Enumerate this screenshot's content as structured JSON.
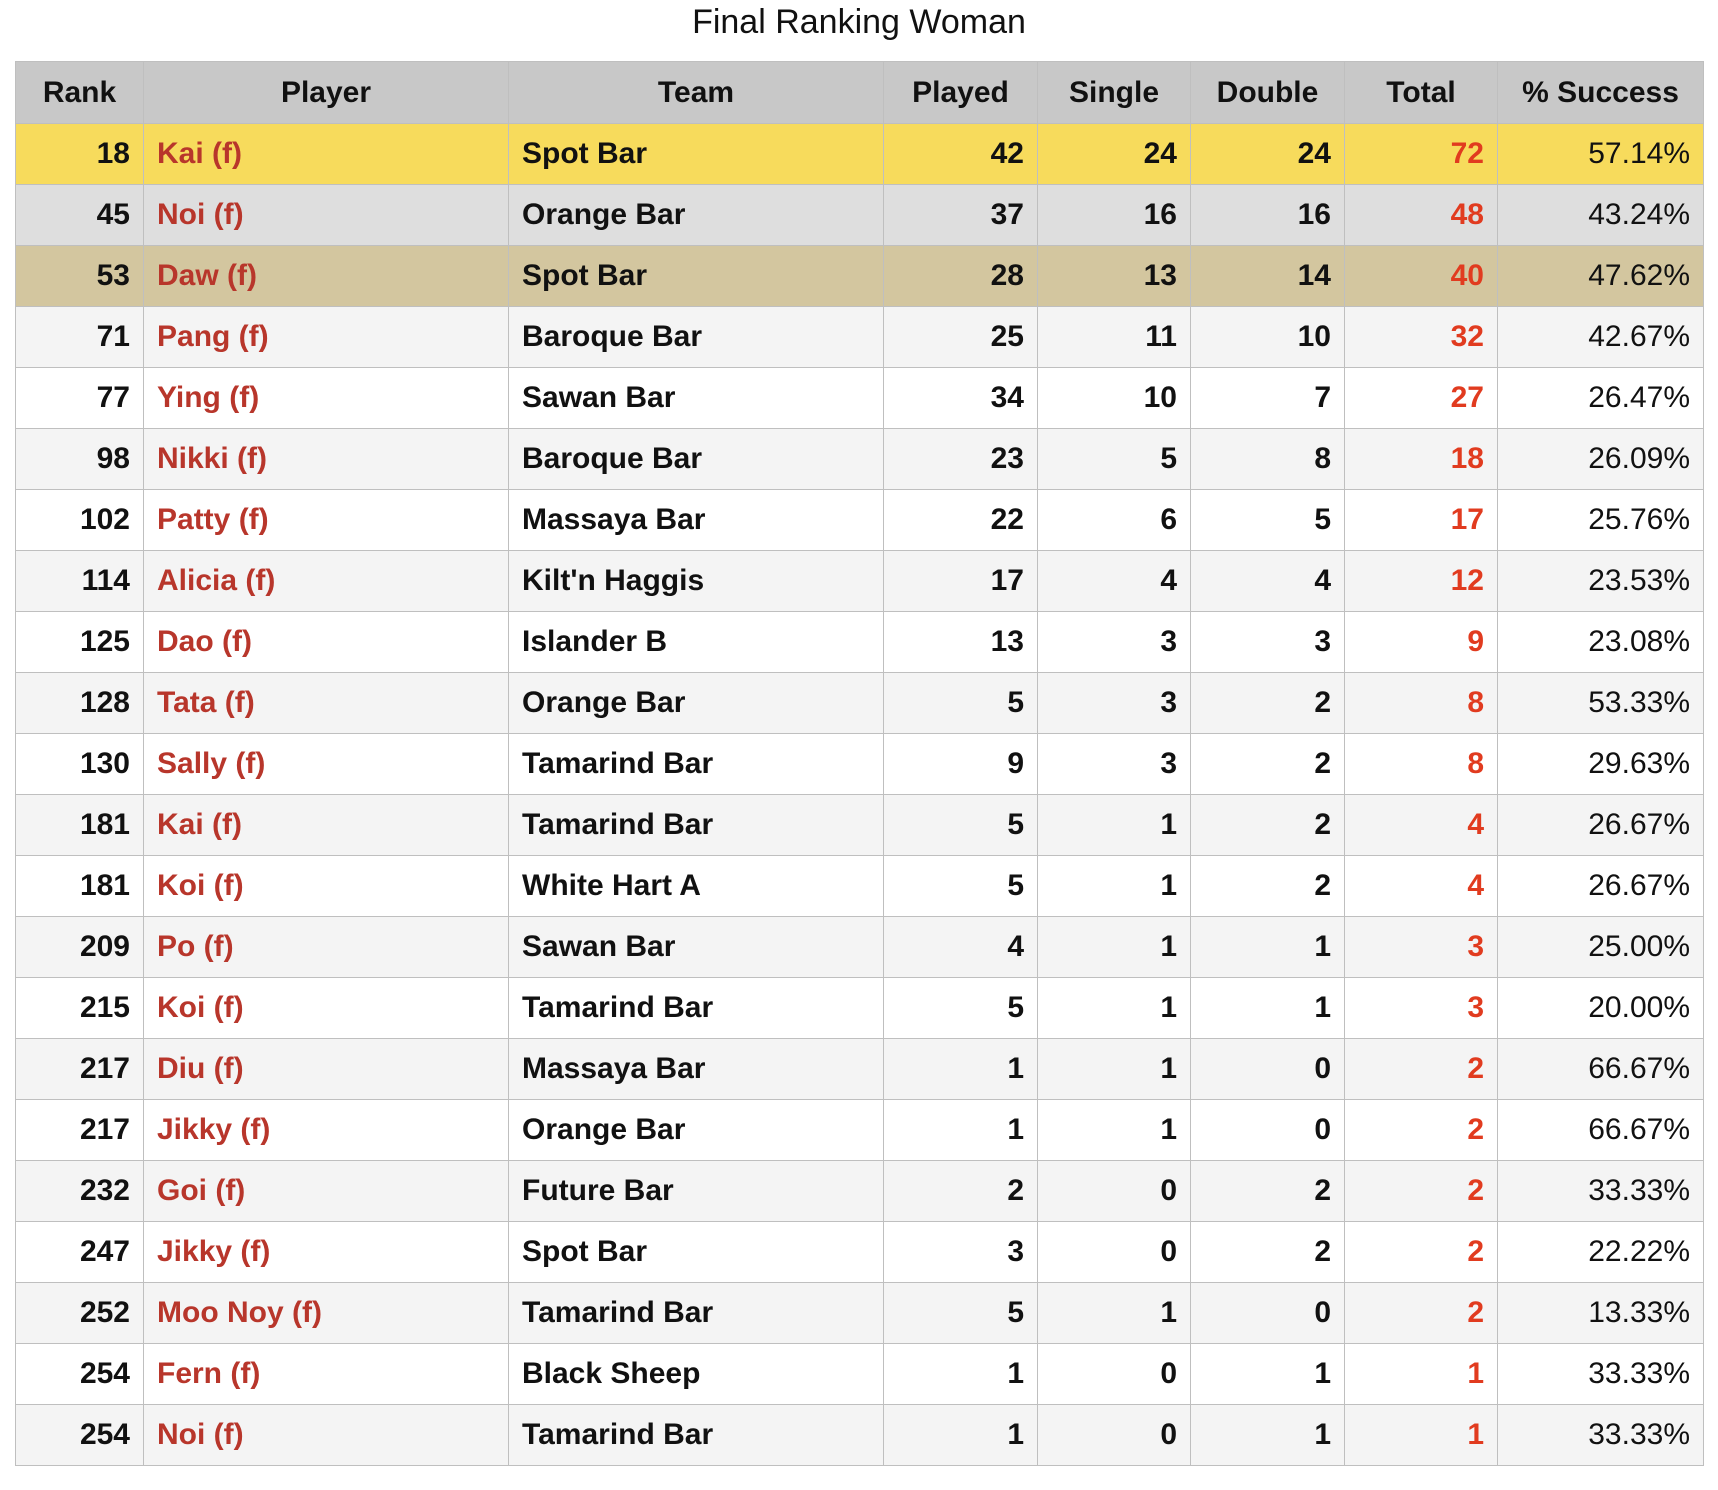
{
  "title": "Final Ranking Woman",
  "columns": [
    "Rank",
    "Player",
    "Team",
    "Played",
    "Single",
    "Double",
    "Total",
    "% Success"
  ],
  "colors": {
    "header_bg": "#c8c8c8",
    "first_place_bg": "#f7db5c",
    "second_place_bg": "#dedede",
    "third_place_bg": "#d3c69f",
    "player_text": "#b8362b",
    "total_text": "#e13b1f"
  },
  "rows": [
    {
      "rank": "18",
      "player": "Kai (f)",
      "team": "Spot Bar",
      "played": "42",
      "single": "24",
      "double": "24",
      "total": "72",
      "success": "57.14%"
    },
    {
      "rank": "45",
      "player": "Noi (f)",
      "team": "Orange Bar",
      "played": "37",
      "single": "16",
      "double": "16",
      "total": "48",
      "success": "43.24%"
    },
    {
      "rank": "53",
      "player": "Daw (f)",
      "team": "Spot Bar",
      "played": "28",
      "single": "13",
      "double": "14",
      "total": "40",
      "success": "47.62%"
    },
    {
      "rank": "71",
      "player": "Pang (f)",
      "team": "Baroque Bar",
      "played": "25",
      "single": "11",
      "double": "10",
      "total": "32",
      "success": "42.67%"
    },
    {
      "rank": "77",
      "player": "Ying (f)",
      "team": "Sawan Bar",
      "played": "34",
      "single": "10",
      "double": "7",
      "total": "27",
      "success": "26.47%"
    },
    {
      "rank": "98",
      "player": "Nikki (f)",
      "team": "Baroque Bar",
      "played": "23",
      "single": "5",
      "double": "8",
      "total": "18",
      "success": "26.09%"
    },
    {
      "rank": "102",
      "player": "Patty (f)",
      "team": "Massaya Bar",
      "played": "22",
      "single": "6",
      "double": "5",
      "total": "17",
      "success": "25.76%"
    },
    {
      "rank": "114",
      "player": "Alicia (f)",
      "team": "Kilt'n Haggis",
      "played": "17",
      "single": "4",
      "double": "4",
      "total": "12",
      "success": "23.53%"
    },
    {
      "rank": "125",
      "player": "Dao (f)",
      "team": "Islander B",
      "played": "13",
      "single": "3",
      "double": "3",
      "total": "9",
      "success": "23.08%"
    },
    {
      "rank": "128",
      "player": "Tata (f)",
      "team": "Orange Bar",
      "played": "5",
      "single": "3",
      "double": "2",
      "total": "8",
      "success": "53.33%"
    },
    {
      "rank": "130",
      "player": "Sally (f)",
      "team": "Tamarind Bar",
      "played": "9",
      "single": "3",
      "double": "2",
      "total": "8",
      "success": "29.63%"
    },
    {
      "rank": "181",
      "player": "Kai (f)",
      "team": "Tamarind Bar",
      "played": "5",
      "single": "1",
      "double": "2",
      "total": "4",
      "success": "26.67%"
    },
    {
      "rank": "181",
      "player": "Koi (f)",
      "team": "White Hart A",
      "played": "5",
      "single": "1",
      "double": "2",
      "total": "4",
      "success": "26.67%"
    },
    {
      "rank": "209",
      "player": "Po (f)",
      "team": "Sawan Bar",
      "played": "4",
      "single": "1",
      "double": "1",
      "total": "3",
      "success": "25.00%"
    },
    {
      "rank": "215",
      "player": "Koi (f)",
      "team": "Tamarind Bar",
      "played": "5",
      "single": "1",
      "double": "1",
      "total": "3",
      "success": "20.00%"
    },
    {
      "rank": "217",
      "player": "Diu (f)",
      "team": "Massaya Bar",
      "played": "1",
      "single": "1",
      "double": "0",
      "total": "2",
      "success": "66.67%"
    },
    {
      "rank": "217",
      "player": "Jikky (f)",
      "team": "Orange Bar",
      "played": "1",
      "single": "1",
      "double": "0",
      "total": "2",
      "success": "66.67%"
    },
    {
      "rank": "232",
      "player": "Goi (f)",
      "team": "Future Bar",
      "played": "2",
      "single": "0",
      "double": "2",
      "total": "2",
      "success": "33.33%"
    },
    {
      "rank": "247",
      "player": "Jikky (f)",
      "team": "Spot Bar",
      "played": "3",
      "single": "0",
      "double": "2",
      "total": "2",
      "success": "22.22%"
    },
    {
      "rank": "252",
      "player": "Moo Noy (f)",
      "team": "Tamarind Bar",
      "played": "5",
      "single": "1",
      "double": "0",
      "total": "2",
      "success": "13.33%"
    },
    {
      "rank": "254",
      "player": "Fern (f)",
      "team": "Black Sheep",
      "played": "1",
      "single": "0",
      "double": "1",
      "total": "1",
      "success": "33.33%"
    },
    {
      "rank": "254",
      "player": "Noi (f)",
      "team": "Tamarind Bar",
      "played": "1",
      "single": "0",
      "double": "1",
      "total": "1",
      "success": "33.33%"
    }
  ]
}
